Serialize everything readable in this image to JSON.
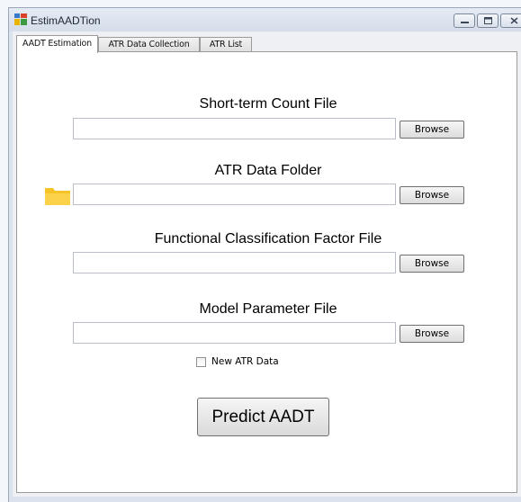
{
  "window": {
    "title": "EstimAADTion"
  },
  "tabs": [
    {
      "label": "AADT Estimation",
      "active": true
    },
    {
      "label": "ATR Data Collection",
      "active": false
    },
    {
      "label": "ATR List",
      "active": false
    }
  ],
  "sections": {
    "short_term": {
      "label": "Short-term Count File",
      "value": "",
      "button": "Browse"
    },
    "atr_folder": {
      "label": "ATR Data Folder",
      "value": "",
      "button": "Browse"
    },
    "functional": {
      "label": "Functional Classification Factor File",
      "value": "",
      "button": "Browse"
    },
    "model_param": {
      "label": "Model Parameter File",
      "value": "",
      "button": "Browse"
    }
  },
  "new_atr_checkbox": {
    "label": "New ATR Data",
    "checked": false
  },
  "predict_button": {
    "label": "Predict AADT"
  },
  "icons": [
    "app-icon",
    "folder-icon",
    "minimize-icon",
    "maximize-icon",
    "close-icon"
  ],
  "colors": {
    "titlebar": "#dbe3ee",
    "folder": "#f7c326",
    "panel": "#ffffff"
  }
}
